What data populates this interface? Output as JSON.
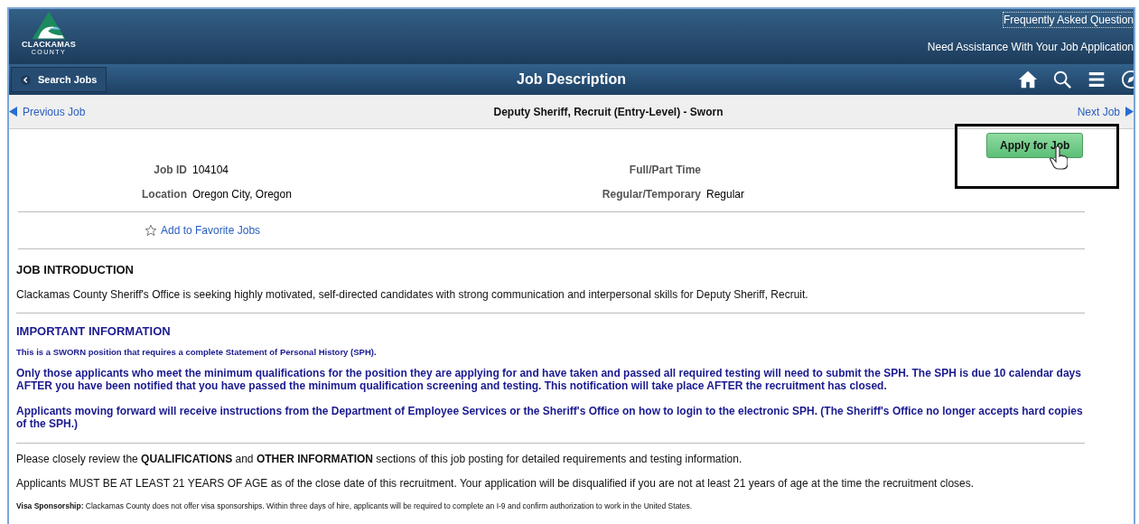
{
  "logo": {
    "name": "CLACKAMAS",
    "sub": "COUNTY"
  },
  "header_links": [
    {
      "label": "Frequently Asked Question",
      "focused": true
    },
    {
      "label": "Need Assistance With Your Job Application",
      "focused": false
    }
  ],
  "nav": {
    "back": "Search Jobs",
    "title": "Job Description"
  },
  "pager": {
    "previous": "Previous Job",
    "title": "Deputy Sheriff, Recruit (Entry-Level) - Sworn",
    "next": "Next Job"
  },
  "apply_button": "Apply for Job",
  "fields_left": [
    {
      "label": "Job ID",
      "value": "104104"
    },
    {
      "label": "Location",
      "value": "Oregon City, Oregon"
    }
  ],
  "fields_right": [
    {
      "label": "Full/Part Time"
    },
    {
      "label": "Regular/Temporary",
      "value": "Regular"
    }
  ],
  "favorite": "Add to Favorite Jobs",
  "intro": {
    "heading": "JOB INTRODUCTION",
    "text": "Clackamas County Sheriff's Office is seeking highly motivated, self-directed candidates with strong communication and interpersonal skills for Deputy Sheriff, Recruit."
  },
  "important": {
    "heading": "IMPORTANT INFORMATION",
    "paragraphs": [
      {
        "kind": "small",
        "text": "This is a SWORN position that requires a complete Statement of Personal History (SPH)."
      },
      {
        "kind": "large",
        "text": "Only those applicants who meet the minimum qualifications for the position they are applying for and have taken and passed all required testing will need to submit the SPH. The SPH is due 10 calendar days AFTER you have been notified that you have passed the minimum qualification screening and testing. This notification will take place AFTER the recruitment has closed."
      },
      {
        "kind": "large",
        "text": "Applicants moving forward will receive instructions from the Department of Employee Services or the Sheriff's Office on how to login to the electronic SPH. (The Sheriff's Office no longer accepts hard copies of the SPH.)"
      }
    ]
  },
  "notes": [
    {
      "kind": "plain",
      "text": "Please closely review the **QUALIFICATIONS** and **OTHER INFORMATION** sections of this job posting for detailed requirements and testing information."
    },
    {
      "kind": "plain",
      "text": "Applicants MUST BE AT LEAST 21 YEARS OF AGE as of the close date of this recruitment. Your application will be disqualified if you are not at least 21 years of age at the time the recruitment closes."
    },
    {
      "kind": "labeled",
      "text": "**Visa Sponsorship:** Clackamas County does not offer visa sponsorships. Within three days of hire, applicants will be required to complete an I-9 and confirm authorization to work in the United States."
    }
  ]
}
